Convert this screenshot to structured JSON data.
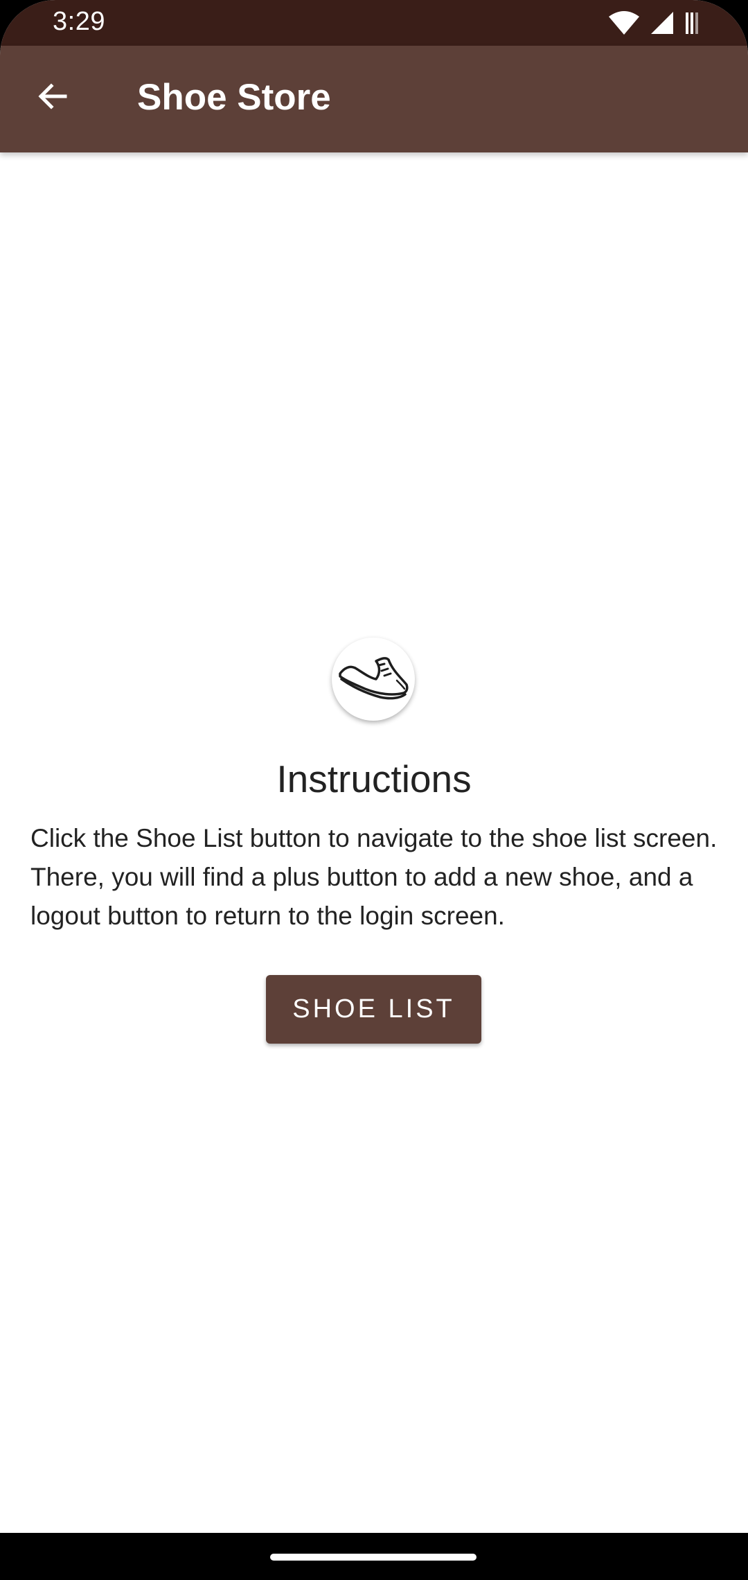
{
  "status_bar": {
    "time": "3:29",
    "icons": [
      "wifi-icon",
      "signal-icon",
      "battery-icon"
    ]
  },
  "app_bar": {
    "title": "Shoe Store",
    "back_icon": "arrow-back-icon"
  },
  "main": {
    "avatar_icon": "sneaker-icon",
    "heading": "Instructions",
    "body": "Click the Shoe List button to navigate to the shoe list screen. There, you will find a plus button to add a new shoe, and a logout button to return to the login screen.",
    "button_label": "SHOE LIST"
  },
  "colors": {
    "status_bar": "#3a1e18",
    "primary": "#5d4038",
    "on_primary": "#ffffff",
    "text": "#222222",
    "background": "#ffffff"
  }
}
